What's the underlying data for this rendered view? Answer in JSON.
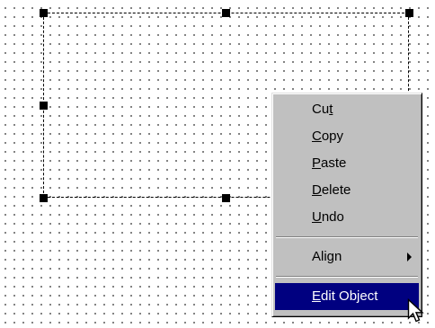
{
  "context_menu": {
    "items": [
      {
        "pre": "Cu",
        "key": "t",
        "post": ""
      },
      {
        "pre": "",
        "key": "C",
        "post": "opy"
      },
      {
        "pre": "",
        "key": "P",
        "post": "aste"
      },
      {
        "pre": "",
        "key": "D",
        "post": "elete"
      },
      {
        "pre": "",
        "key": "U",
        "post": "ndo"
      }
    ],
    "align": {
      "label": "Align",
      "submenu_icon": "chevron-right-icon"
    },
    "edit": {
      "pre": "",
      "key": "E",
      "post": "dit Object"
    }
  },
  "colors": {
    "menu_bg": "#c0c0c0",
    "highlight": "#000080",
    "grid_dot": "#4a4a4a"
  },
  "icons": {
    "cursor": "arrow-pointer-icon",
    "handle": "resize-handle-icon"
  }
}
